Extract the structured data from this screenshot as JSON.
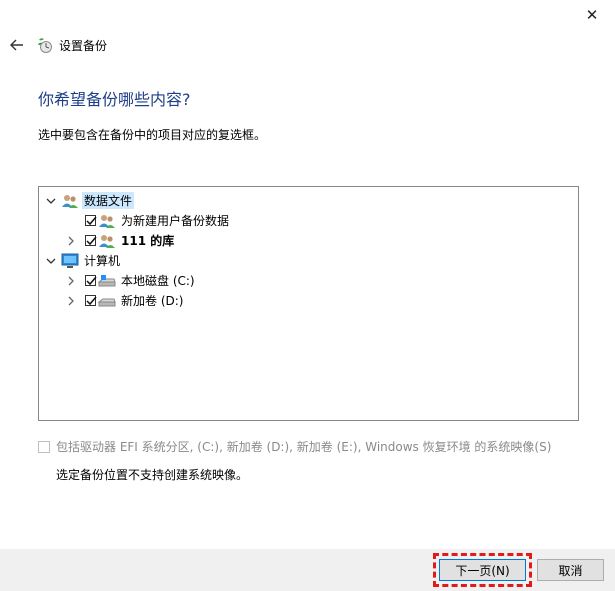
{
  "window": {
    "title": "设置备份",
    "close_glyph": "✕"
  },
  "page": {
    "heading": "你希望备份哪些内容?",
    "instruction": "选中要包含在备份中的项目对应的复选框。"
  },
  "tree": {
    "items": [
      {
        "label": "数据文件",
        "expanded": true,
        "selected": true,
        "icon": "users-icon"
      },
      {
        "label": "为新建用户备份数据",
        "checked": true,
        "icon": "users-icon"
      },
      {
        "label": "111 的库",
        "checked": true,
        "icon": "users-icon",
        "bold": true
      },
      {
        "label": "计算机",
        "expanded": true,
        "icon": "computer-icon"
      },
      {
        "label": "本地磁盘 (C:)",
        "checked": true,
        "icon": "drive-icon"
      },
      {
        "label": "新加卷 (D:)",
        "checked": true,
        "icon": "drive-icon"
      }
    ]
  },
  "system_image": {
    "label": "包括驱动器 EFI 系统分区, (C:), 新加卷 (D:), 新加卷 (E:), Windows 恢复环境 的系统映像(S)",
    "checked": false,
    "disabled": true
  },
  "note": "选定备份位置不支持创建系统映像。",
  "buttons": {
    "next": "下一页(N)",
    "cancel": "取消"
  },
  "colors": {
    "heading": "#1f3f8a",
    "selection": "#cce8ff",
    "highlight": "#e21a1a",
    "accent": "#0078d7"
  }
}
